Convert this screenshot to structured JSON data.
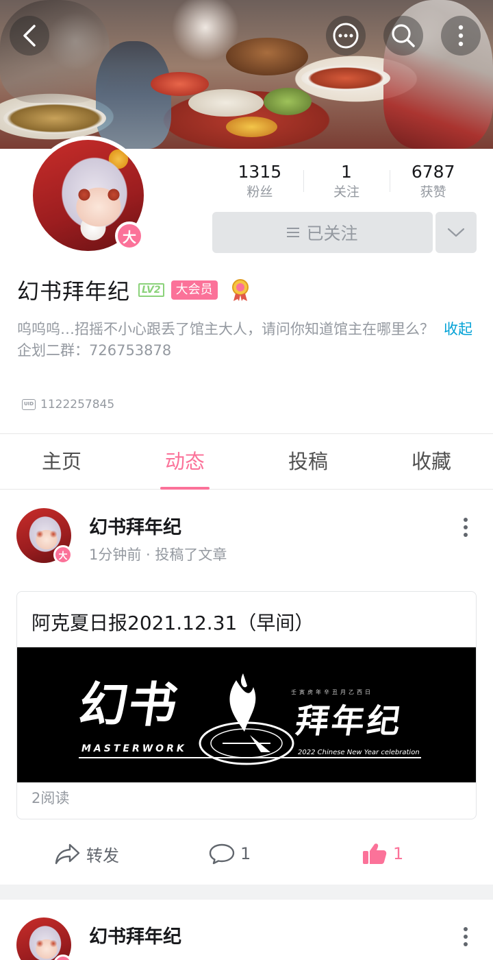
{
  "header": {
    "back_icon": "chevron-left-icon",
    "more_icon": "chat-bubble-dots-icon",
    "search_icon": "search-icon",
    "menu_icon": "vertical-dots-icon"
  },
  "profile": {
    "vip_badge": "大",
    "stats": [
      {
        "value": "1315",
        "label": "粉丝"
      },
      {
        "value": "1",
        "label": "关注"
      },
      {
        "value": "6787",
        "label": "获赞"
      }
    ],
    "follow_button": "已关注",
    "username": "幻书拜年纪",
    "level": "LV2",
    "member_badge": "大会员",
    "bio_line1": "呜呜呜…招摇不小心跟丢了馆主大人，请问你知道馆主在哪里么？",
    "bio_line2": "企划二群：726753878",
    "collapse_label": "收起",
    "uid_label": "UID",
    "uid": "1122257845"
  },
  "tabs": [
    {
      "label": "主页",
      "active": false
    },
    {
      "label": "动态",
      "active": true
    },
    {
      "label": "投稿",
      "active": false
    },
    {
      "label": "收藏",
      "active": false
    }
  ],
  "posts": [
    {
      "author": "幻书拜年纪",
      "vip_badge": "大",
      "meta": "1分钟前 · 投稿了文章",
      "article": {
        "title": "阿克夏日报2021.12.31（早间）",
        "cover_text_left": "幻书",
        "cover_text_right": "拜年纪",
        "cover_text_en": "MASTERWORK",
        "cover_text_sub": "2022 Chinese New Year celebration",
        "cover_text_top": "壬寅虎年辛丑月乙西日",
        "reads": "2阅读"
      },
      "actions": {
        "share": "转发",
        "comments": "1",
        "likes": "1"
      }
    },
    {
      "author": "幻书拜年纪",
      "vip_badge": "大"
    }
  ],
  "colors": {
    "accent": "#fb7299",
    "link": "#00a1d6",
    "muted": "#9499a0",
    "button_bg": "#e3e5e7",
    "level_green": "#8bd27a"
  }
}
